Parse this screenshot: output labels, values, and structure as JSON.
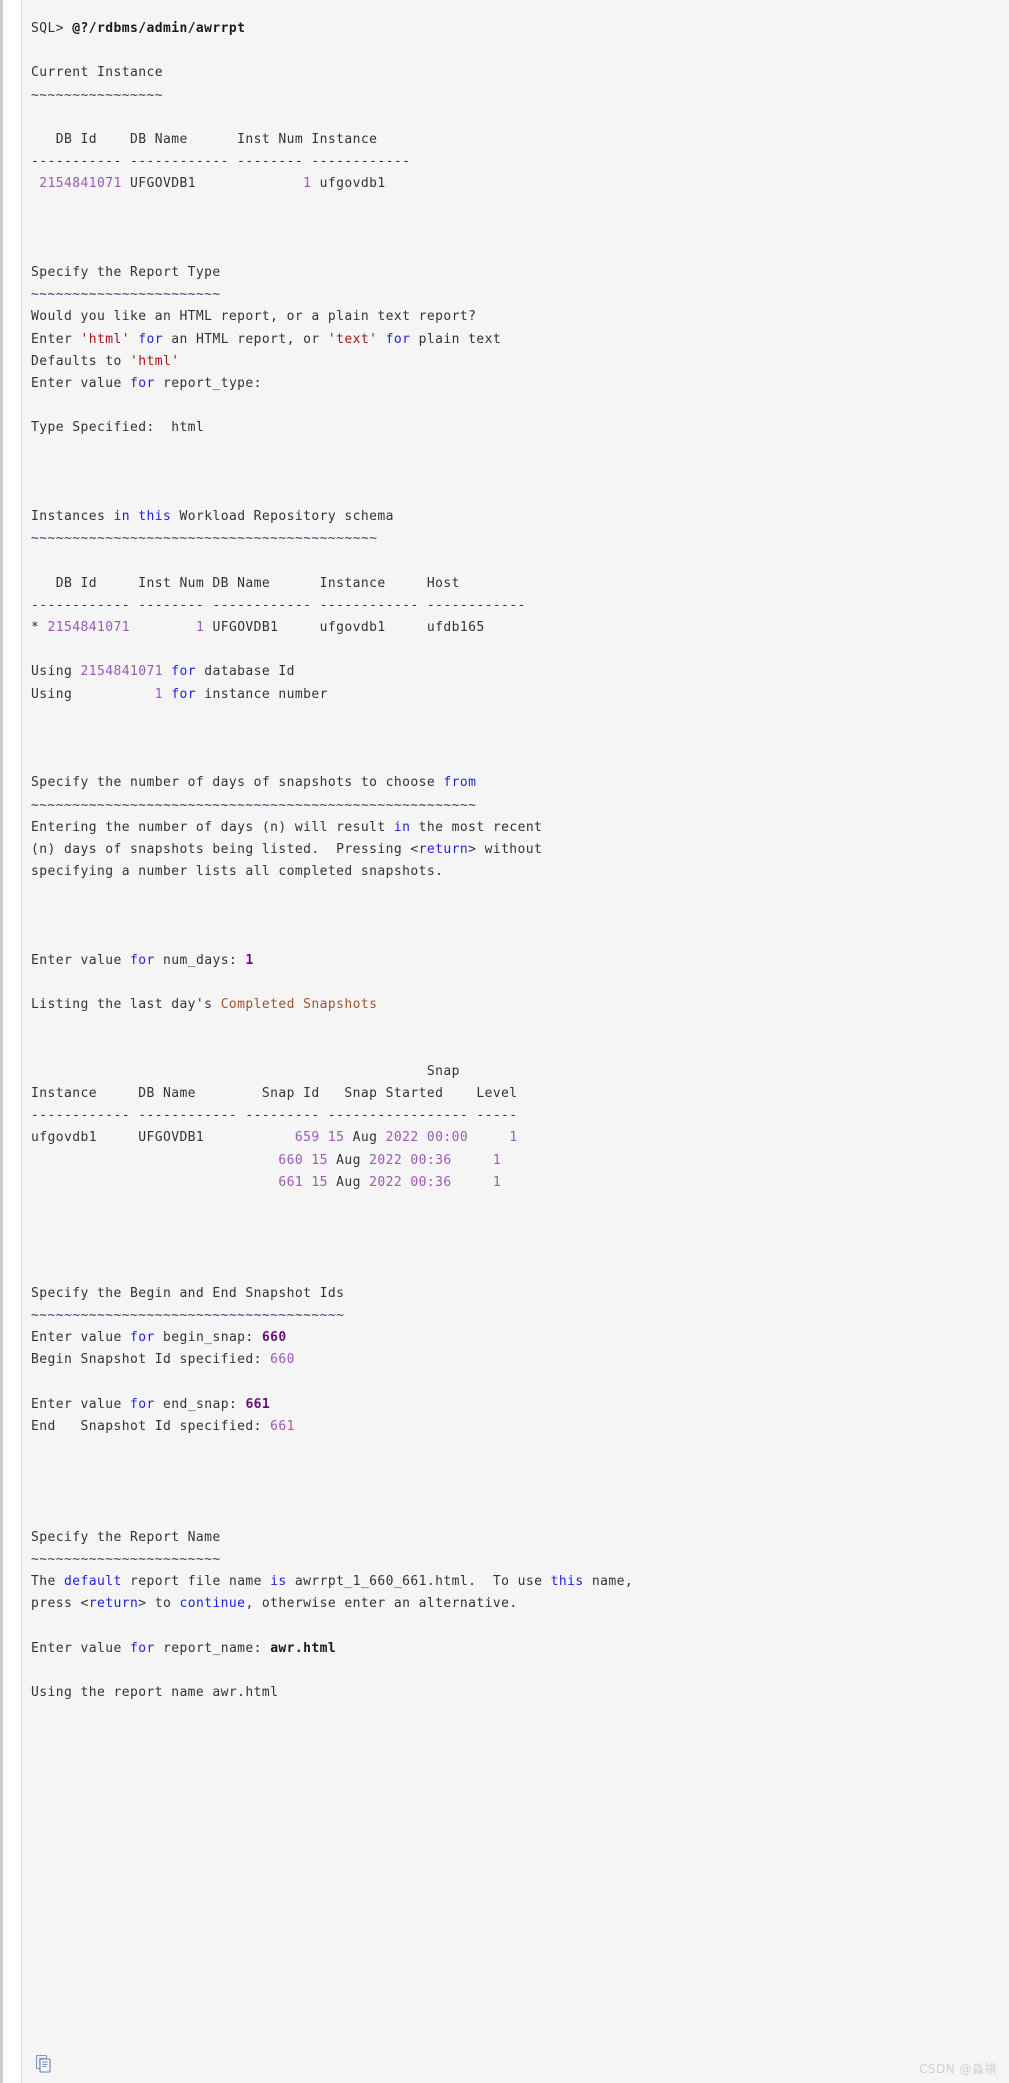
{
  "app": {
    "kind": "sqlplus-console-output",
    "background": "#f5f5f5",
    "colors": {
      "text": "#333333",
      "keyword": "#2222dd",
      "string": "#a31515",
      "string_alt": "#a0522d",
      "number": "#9b59b6",
      "user_input": "#6a0d7a",
      "tilde": "#3b3b6b",
      "watermark": "#d0d0d0"
    }
  },
  "watermark": "CSDN @淼祺",
  "icons": {
    "copy": "copy-icon"
  },
  "console": {
    "prompt": "SQL> ",
    "command": "@?/rdbms/admin/awrrpt",
    "lines": [
      {
        "id": "l1",
        "segments": [
          {
            "t": "SQL> ",
            "c": "plain"
          },
          {
            "t": "@?/rdbms/admin/awrrpt",
            "c": "bold"
          }
        ]
      },
      {
        "id": "l2",
        "segments": []
      },
      {
        "id": "l3",
        "segments": [
          {
            "t": "Current Instance",
            "c": "plain"
          }
        ]
      },
      {
        "id": "l4",
        "segments": [
          {
            "t": "~~~~~~~~~~~~~~~~",
            "c": "tilde"
          }
        ]
      },
      {
        "id": "l5",
        "segments": []
      },
      {
        "id": "l6",
        "segments": [
          {
            "t": "   DB Id    DB Name      Inst Num Instance",
            "c": "plain"
          }
        ]
      },
      {
        "id": "l7",
        "segments": [
          {
            "t": "----------- ------------ -------- ------------",
            "c": "plain"
          }
        ]
      },
      {
        "id": "l8",
        "segments": [
          {
            "t": " ",
            "c": "plain"
          },
          {
            "t": "2154841071",
            "c": "num"
          },
          {
            "t": " UFGOVDB1             ",
            "c": "plain"
          },
          {
            "t": "1",
            "c": "num"
          },
          {
            "t": " ufgovdb1",
            "c": "plain"
          }
        ]
      },
      {
        "id": "l9",
        "segments": []
      },
      {
        "id": "l10",
        "segments": []
      },
      {
        "id": "l11",
        "segments": []
      },
      {
        "id": "l12",
        "segments": [
          {
            "t": "Specify the Report Type",
            "c": "plain"
          }
        ]
      },
      {
        "id": "l13",
        "segments": [
          {
            "t": "~~~~~~~~~~~~~~~~~~~~~~~",
            "c": "tilde"
          }
        ]
      },
      {
        "id": "l14",
        "segments": [
          {
            "t": "Would you like an HTML report, or a plain text report?",
            "c": "plain"
          }
        ]
      },
      {
        "id": "l15",
        "segments": [
          {
            "t": "Enter ",
            "c": "plain"
          },
          {
            "t": "'html'",
            "c": "str"
          },
          {
            "t": " ",
            "c": "plain"
          },
          {
            "t": "for",
            "c": "kw"
          },
          {
            "t": " an HTML report, or ",
            "c": "plain"
          },
          {
            "t": "'text'",
            "c": "str"
          },
          {
            "t": " ",
            "c": "plain"
          },
          {
            "t": "for",
            "c": "kw"
          },
          {
            "t": " plain text",
            "c": "plain"
          }
        ]
      },
      {
        "id": "l16",
        "segments": [
          {
            "t": "Defaults to ",
            "c": "plain"
          },
          {
            "t": "'html'",
            "c": "str"
          }
        ]
      },
      {
        "id": "l17",
        "segments": [
          {
            "t": "Enter value ",
            "c": "plain"
          },
          {
            "t": "for",
            "c": "kw"
          },
          {
            "t": " report_type:",
            "c": "plain"
          }
        ]
      },
      {
        "id": "l18",
        "segments": []
      },
      {
        "id": "l19",
        "segments": [
          {
            "t": "Type Specified:  html",
            "c": "plain"
          }
        ]
      },
      {
        "id": "l20",
        "segments": []
      },
      {
        "id": "l21",
        "segments": []
      },
      {
        "id": "l22",
        "segments": []
      },
      {
        "id": "l23",
        "segments": [
          {
            "t": "Instances ",
            "c": "plain"
          },
          {
            "t": "in",
            "c": "kw"
          },
          {
            "t": " ",
            "c": "plain"
          },
          {
            "t": "this",
            "c": "kw"
          },
          {
            "t": " Workload Repository schema",
            "c": "plain"
          }
        ]
      },
      {
        "id": "l24",
        "segments": [
          {
            "t": "~~~~~~~~~~~~~~~~~~~~~~~~~~~~~~~~~~~~~~~~~~",
            "c": "tilde"
          }
        ]
      },
      {
        "id": "l25",
        "segments": []
      },
      {
        "id": "l26",
        "segments": [
          {
            "t": "   DB Id     Inst Num DB Name      Instance     Host",
            "c": "plain"
          }
        ]
      },
      {
        "id": "l27",
        "segments": [
          {
            "t": "------------ -------- ------------ ------------ ------------",
            "c": "plain"
          }
        ]
      },
      {
        "id": "l28",
        "segments": [
          {
            "t": "* ",
            "c": "plain"
          },
          {
            "t": "2154841071",
            "c": "num"
          },
          {
            "t": "        ",
            "c": "plain"
          },
          {
            "t": "1",
            "c": "num"
          },
          {
            "t": " UFGOVDB1     ufgovdb1     ufdb165",
            "c": "plain"
          }
        ]
      },
      {
        "id": "l29",
        "segments": []
      },
      {
        "id": "l30",
        "segments": [
          {
            "t": "Using ",
            "c": "plain"
          },
          {
            "t": "2154841071",
            "c": "num"
          },
          {
            "t": " ",
            "c": "plain"
          },
          {
            "t": "for",
            "c": "kw"
          },
          {
            "t": " database Id",
            "c": "plain"
          }
        ]
      },
      {
        "id": "l31",
        "segments": [
          {
            "t": "Using          ",
            "c": "plain"
          },
          {
            "t": "1",
            "c": "num"
          },
          {
            "t": " ",
            "c": "plain"
          },
          {
            "t": "for",
            "c": "kw"
          },
          {
            "t": " instance number",
            "c": "plain"
          }
        ]
      },
      {
        "id": "l32",
        "segments": []
      },
      {
        "id": "l33",
        "segments": []
      },
      {
        "id": "l34",
        "segments": []
      },
      {
        "id": "l35",
        "segments": [
          {
            "t": "Specify the number of days of snapshots to choose ",
            "c": "plain"
          },
          {
            "t": "from",
            "c": "kw"
          }
        ]
      },
      {
        "id": "l36",
        "segments": [
          {
            "t": "~~~~~~~~~~~~~~~~~~~~~~~~~~~~~~~~~~~~~~~~~~~~~~~~~~~~~~",
            "c": "tilde"
          }
        ]
      },
      {
        "id": "l37",
        "segments": [
          {
            "t": "Entering the number of days (n) will result ",
            "c": "plain"
          },
          {
            "t": "in",
            "c": "kw"
          },
          {
            "t": " the most recent",
            "c": "plain"
          }
        ]
      },
      {
        "id": "l38",
        "segments": [
          {
            "t": "(n) days of snapshots being listed.  Pressing <",
            "c": "plain"
          },
          {
            "t": "return",
            "c": "kw"
          },
          {
            "t": "> without",
            "c": "plain"
          }
        ]
      },
      {
        "id": "l39",
        "segments": [
          {
            "t": "specifying a number lists all completed snapshots.",
            "c": "plain"
          }
        ]
      },
      {
        "id": "l40",
        "segments": []
      },
      {
        "id": "l41",
        "segments": []
      },
      {
        "id": "l42",
        "segments": []
      },
      {
        "id": "l43",
        "segments": [
          {
            "t": "Enter value ",
            "c": "plain"
          },
          {
            "t": "for",
            "c": "kw"
          },
          {
            "t": " num_days: ",
            "c": "plain"
          },
          {
            "t": "1",
            "c": "input"
          }
        ]
      },
      {
        "id": "l44",
        "segments": []
      },
      {
        "id": "l45",
        "segments": [
          {
            "t": "Listing the last day's ",
            "c": "plain"
          },
          {
            "t": "Completed Snapshots",
            "c": "str2"
          }
        ]
      },
      {
        "id": "l46",
        "segments": []
      },
      {
        "id": "l47",
        "segments": []
      },
      {
        "id": "l48",
        "segments": [
          {
            "t": "                                                Snap",
            "c": "plain"
          }
        ]
      },
      {
        "id": "l49",
        "segments": [
          {
            "t": "Instance     DB Name        Snap Id   Snap Started    Level",
            "c": "plain"
          }
        ]
      },
      {
        "id": "l50",
        "segments": [
          {
            "t": "------------ ------------ --------- ----------------- -----",
            "c": "plain"
          }
        ]
      },
      {
        "id": "l51",
        "segments": [
          {
            "t": "ufgovdb1     UFGOVDB1           ",
            "c": "plain"
          },
          {
            "t": "659",
            "c": "num"
          },
          {
            "t": " ",
            "c": "plain"
          },
          {
            "t": "15",
            "c": "num"
          },
          {
            "t": " Aug ",
            "c": "plain"
          },
          {
            "t": "2022",
            "c": "num"
          },
          {
            "t": " ",
            "c": "plain"
          },
          {
            "t": "00:00",
            "c": "num"
          },
          {
            "t": "     ",
            "c": "plain"
          },
          {
            "t": "1",
            "c": "num"
          }
        ]
      },
      {
        "id": "l52",
        "segments": [
          {
            "t": "                              ",
            "c": "plain"
          },
          {
            "t": "660",
            "c": "num"
          },
          {
            "t": " ",
            "c": "plain"
          },
          {
            "t": "15",
            "c": "num"
          },
          {
            "t": " Aug ",
            "c": "plain"
          },
          {
            "t": "2022",
            "c": "num"
          },
          {
            "t": " ",
            "c": "plain"
          },
          {
            "t": "00:36",
            "c": "num"
          },
          {
            "t": "     ",
            "c": "plain"
          },
          {
            "t": "1",
            "c": "num"
          }
        ]
      },
      {
        "id": "l53",
        "segments": [
          {
            "t": "                              ",
            "c": "plain"
          },
          {
            "t": "661",
            "c": "num"
          },
          {
            "t": " ",
            "c": "plain"
          },
          {
            "t": "15",
            "c": "num"
          },
          {
            "t": " Aug ",
            "c": "plain"
          },
          {
            "t": "2022",
            "c": "num"
          },
          {
            "t": " ",
            "c": "plain"
          },
          {
            "t": "00:36",
            "c": "num"
          },
          {
            "t": "     ",
            "c": "plain"
          },
          {
            "t": "1",
            "c": "num"
          }
        ]
      },
      {
        "id": "l54",
        "segments": []
      },
      {
        "id": "l55",
        "segments": []
      },
      {
        "id": "l56",
        "segments": []
      },
      {
        "id": "l57",
        "segments": []
      },
      {
        "id": "l58",
        "segments": [
          {
            "t": "Specify the Begin and End Snapshot Ids",
            "c": "plain"
          }
        ]
      },
      {
        "id": "l59",
        "segments": [
          {
            "t": "~~~~~~~~~~~~~~~~~~~~~~~~~~~~~~~~~~~~~~",
            "c": "tilde"
          }
        ]
      },
      {
        "id": "l60",
        "segments": [
          {
            "t": "Enter value ",
            "c": "plain"
          },
          {
            "t": "for",
            "c": "kw"
          },
          {
            "t": " begin_snap: ",
            "c": "plain"
          },
          {
            "t": "660",
            "c": "input"
          }
        ]
      },
      {
        "id": "l61",
        "segments": [
          {
            "t": "Begin Snapshot Id specified: ",
            "c": "plain"
          },
          {
            "t": "660",
            "c": "num"
          }
        ]
      },
      {
        "id": "l62",
        "segments": []
      },
      {
        "id": "l63",
        "segments": [
          {
            "t": "Enter value ",
            "c": "plain"
          },
          {
            "t": "for",
            "c": "kw"
          },
          {
            "t": " end_snap: ",
            "c": "plain"
          },
          {
            "t": "661",
            "c": "input"
          }
        ]
      },
      {
        "id": "l64",
        "segments": [
          {
            "t": "End   Snapshot Id specified: ",
            "c": "plain"
          },
          {
            "t": "661",
            "c": "num"
          }
        ]
      },
      {
        "id": "l65",
        "segments": []
      },
      {
        "id": "l66",
        "segments": []
      },
      {
        "id": "l67",
        "segments": []
      },
      {
        "id": "l68",
        "segments": []
      },
      {
        "id": "l69",
        "segments": [
          {
            "t": "Specify the Report Name",
            "c": "plain"
          }
        ]
      },
      {
        "id": "l70",
        "segments": [
          {
            "t": "~~~~~~~~~~~~~~~~~~~~~~~",
            "c": "tilde"
          }
        ]
      },
      {
        "id": "l71",
        "segments": [
          {
            "t": "The ",
            "c": "plain"
          },
          {
            "t": "default",
            "c": "kw"
          },
          {
            "t": " report file name ",
            "c": "plain"
          },
          {
            "t": "is",
            "c": "kw"
          },
          {
            "t": " awrrpt_1_660_661.html.  To use ",
            "c": "plain"
          },
          {
            "t": "this",
            "c": "kw"
          },
          {
            "t": " name,",
            "c": "plain"
          }
        ]
      },
      {
        "id": "l72",
        "segments": [
          {
            "t": "press <",
            "c": "plain"
          },
          {
            "t": "return",
            "c": "kw"
          },
          {
            "t": "> to ",
            "c": "plain"
          },
          {
            "t": "continue",
            "c": "kw"
          },
          {
            "t": ", otherwise enter an alternative.",
            "c": "plain"
          }
        ]
      },
      {
        "id": "l73",
        "segments": []
      },
      {
        "id": "l74",
        "segments": [
          {
            "t": "Enter value ",
            "c": "plain"
          },
          {
            "t": "for",
            "c": "kw"
          },
          {
            "t": " report_name: ",
            "c": "plain"
          },
          {
            "t": "awr.html",
            "c": "bold"
          }
        ]
      },
      {
        "id": "l75",
        "segments": []
      },
      {
        "id": "l76",
        "segments": [
          {
            "t": "Using the report name awr.html",
            "c": "plain"
          }
        ]
      }
    ]
  },
  "tables": {
    "current_instance": {
      "headers": [
        "DB Id",
        "DB Name",
        "Inst Num",
        "Instance"
      ],
      "rows": [
        [
          "2154841071",
          "UFGOVDB1",
          "1",
          "ufgovdb1"
        ]
      ]
    },
    "repository_instances": {
      "headers": [
        "DB Id",
        "Inst Num",
        "DB Name",
        "Instance",
        "Host"
      ],
      "rows": [
        [
          "2154841071",
          "1",
          "UFGOVDB1",
          "ufgovdb1",
          "ufdb165"
        ]
      ],
      "selected_marker": "*"
    },
    "completed_snapshots": {
      "headers": [
        "Instance",
        "DB Name",
        "Snap Id",
        "Snap Started",
        "Snap Level"
      ],
      "rows": [
        [
          "ufgovdb1",
          "UFGOVDB1",
          "659",
          "15 Aug 2022 00:00",
          "1"
        ],
        [
          "",
          "",
          "660",
          "15 Aug 2022 00:36",
          "1"
        ],
        [
          "",
          "",
          "661",
          "15 Aug 2022 00:36",
          "1"
        ]
      ]
    }
  },
  "prompts": {
    "report_type": {
      "label": "Enter value for report_type:",
      "value": "",
      "specified": "html"
    },
    "num_days": {
      "label": "Enter value for num_days:",
      "value": "1"
    },
    "begin_snap": {
      "label": "Enter value for begin_snap:",
      "value": "660",
      "specified": "660"
    },
    "end_snap": {
      "label": "Enter value for end_snap:",
      "value": "661",
      "specified": "661"
    },
    "report_name": {
      "label": "Enter value for report_name:",
      "value": "awr.html",
      "default": "awrrpt_1_660_661.html",
      "using": "awr.html"
    }
  }
}
